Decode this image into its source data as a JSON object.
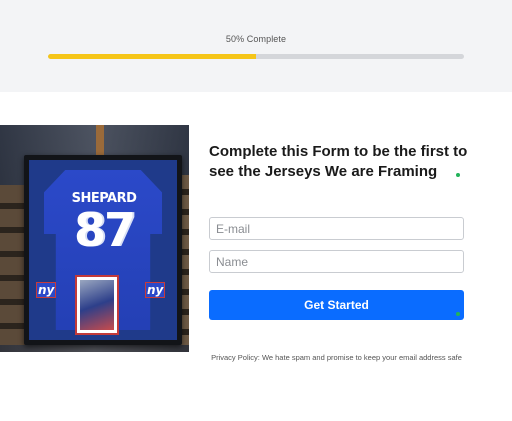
{
  "progress": {
    "label": "50% Complete",
    "value": 0.5,
    "fill_color": "#f5c518",
    "track_color": "#d4d6da"
  },
  "image": {
    "jersey_name": "SHEPARD",
    "jersey_number": "87",
    "team_logo_text": "ny"
  },
  "form": {
    "headline": "Complete this Form to be the first to see the Jerseys We are Framing",
    "email_placeholder": "E-mail",
    "name_placeholder": "Name",
    "submit_label": "Get Started",
    "button_color": "#0a6cff"
  },
  "footer": {
    "privacy_text": "Privacy Policy: We hate spam and promise to keep your email address safe"
  }
}
